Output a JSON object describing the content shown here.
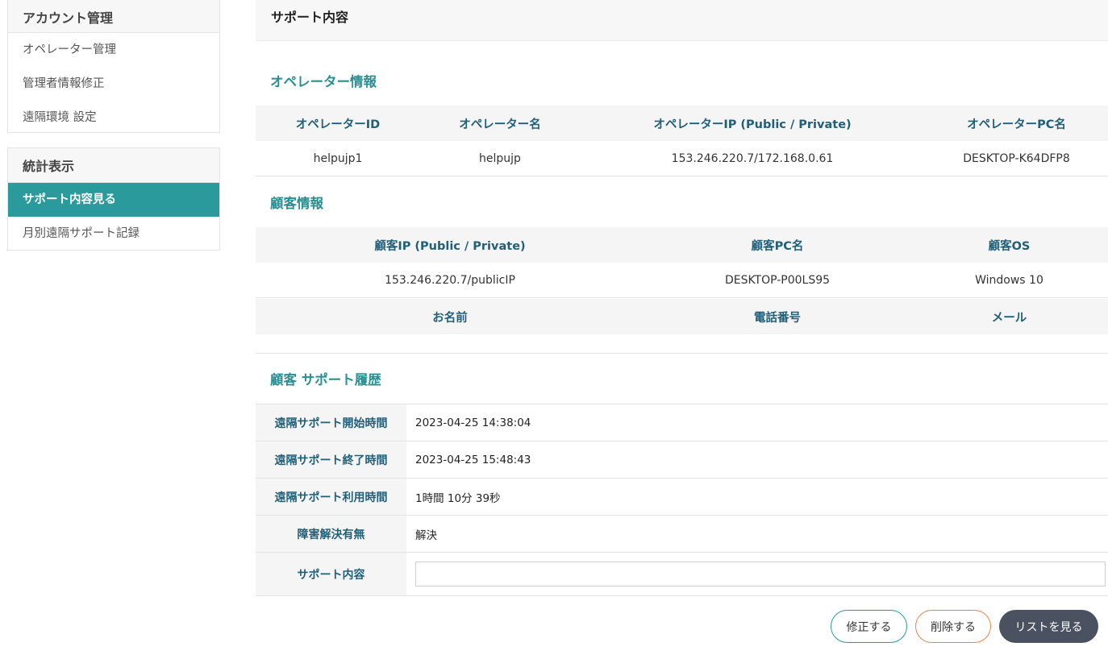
{
  "sidebar": {
    "account": {
      "title": "アカウント管理",
      "items": [
        "オペレーター管理",
        "管理者情報修正",
        "遠隔環境 設定"
      ]
    },
    "stats": {
      "title": "統計表示",
      "items": [
        {
          "label": "サポート内容見る",
          "active": true
        },
        {
          "label": "月別遠隔サポート記録",
          "active": false
        }
      ]
    }
  },
  "page": {
    "title": "サポート内容"
  },
  "operator": {
    "title": "オペレーター情報",
    "headers": [
      "オペレーターID",
      "オペレーター名",
      "オペレーターIP (Public / Private)",
      "オペレーターPC名"
    ],
    "values": [
      "helpujp1",
      "helpujp",
      "153.246.220.7/172.168.0.61",
      "DESKTOP-K64DFP8"
    ]
  },
  "customer": {
    "title": "顧客情報",
    "headers": [
      "顧客IP (Public / Private)",
      "顧客PC名",
      "顧客OS"
    ],
    "values": [
      "153.246.220.7/publicIP",
      "DESKTOP-P00LS95",
      "Windows 10"
    ],
    "headers2": [
      "お名前",
      "電話番号",
      "メール"
    ]
  },
  "history": {
    "title": "顧客 サポート履歴",
    "rows": [
      {
        "label": "遠隔サポート開始時間",
        "value": "2023-04-25 14:38:04"
      },
      {
        "label": "遠隔サポート終了時間",
        "value": "2023-04-25 15:48:43"
      },
      {
        "label": "遠隔サポート利用時間",
        "value": "1時間 10分 39秒"
      },
      {
        "label": "障害解決有無",
        "value": "解決"
      }
    ],
    "content_label": "サポート内容",
    "content_value": ""
  },
  "buttons": {
    "edit": "修正する",
    "delete": "削除する",
    "list": "リストを見る"
  },
  "colors": {
    "accent": "#2a9a9c",
    "header_text": "#1f5f7a",
    "delete_border": "#e8834c",
    "list_button": "#4a5261"
  }
}
